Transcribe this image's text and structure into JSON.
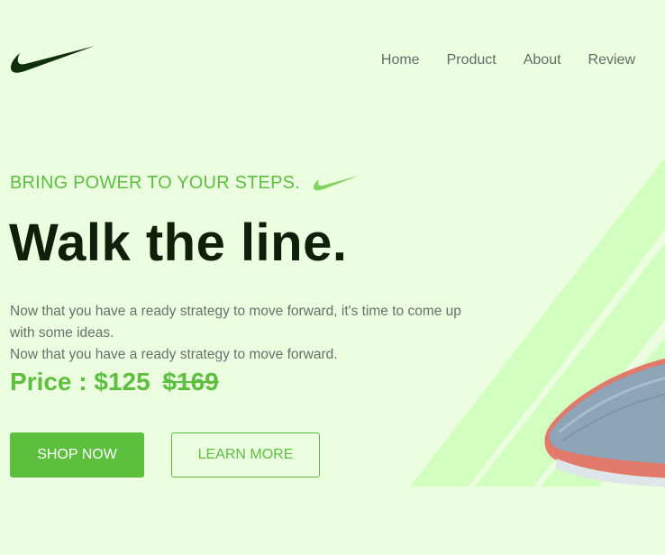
{
  "brand": {
    "logo_icon": "nike-swoosh-icon",
    "colors": {
      "accent": "#5cbf3e",
      "dark": "#0f1f0a",
      "background": "#ebffe0"
    }
  },
  "nav": {
    "items": [
      {
        "label": "Home"
      },
      {
        "label": "Product"
      },
      {
        "label": "About"
      },
      {
        "label": "Review"
      }
    ]
  },
  "hero": {
    "tagline": "BRING POWER TO YOUR STEPS.",
    "title": "Walk the line.",
    "description": [
      "Now that you have a ready strategy to move forward, it's time to come up with some ideas.",
      "Now that you have a ready strategy to move forward."
    ],
    "price_label": "Price :",
    "price_current": "$125",
    "price_old": "$169",
    "buttons": {
      "shop": "SHOP NOW",
      "learn": "LEARN MORE"
    }
  }
}
